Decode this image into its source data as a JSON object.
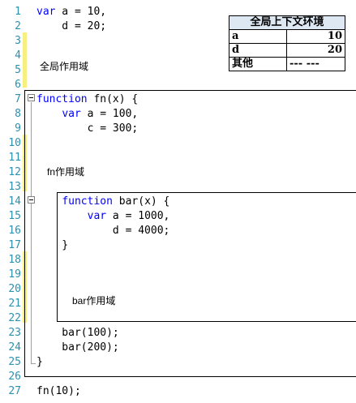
{
  "code": {
    "lines": [
      {
        "num": "1",
        "parts": [
          {
            "t": "var",
            "kw": true
          },
          {
            "t": " a = 10,"
          }
        ]
      },
      {
        "num": "2",
        "parts": [
          {
            "t": "    d = 20;"
          }
        ]
      },
      {
        "num": "3",
        "parts": []
      },
      {
        "num": "4",
        "parts": []
      },
      {
        "num": "5",
        "parts": []
      },
      {
        "num": "6",
        "parts": []
      },
      {
        "num": "7",
        "parts": [
          {
            "t": "function",
            "kw": true
          },
          {
            "t": " fn(x) {"
          }
        ]
      },
      {
        "num": "8",
        "parts": [
          {
            "t": "    "
          },
          {
            "t": "var",
            "kw": true
          },
          {
            "t": " a = 100,"
          }
        ]
      },
      {
        "num": "9",
        "parts": [
          {
            "t": "        c = 300;"
          }
        ]
      },
      {
        "num": "10",
        "parts": []
      },
      {
        "num": "11",
        "parts": []
      },
      {
        "num": "12",
        "parts": []
      },
      {
        "num": "13",
        "parts": []
      },
      {
        "num": "14",
        "parts": [
          {
            "t": "    "
          },
          {
            "t": "function",
            "kw": true
          },
          {
            "t": " bar(x) {"
          }
        ]
      },
      {
        "num": "15",
        "parts": [
          {
            "t": "        "
          },
          {
            "t": "var",
            "kw": true
          },
          {
            "t": " a = 1000,"
          }
        ]
      },
      {
        "num": "16",
        "parts": [
          {
            "t": "            d = 4000;"
          }
        ]
      },
      {
        "num": "17",
        "parts": [
          {
            "t": "    }"
          }
        ]
      },
      {
        "num": "18",
        "parts": []
      },
      {
        "num": "19",
        "parts": []
      },
      {
        "num": "20",
        "parts": []
      },
      {
        "num": "21",
        "parts": []
      },
      {
        "num": "22",
        "parts": []
      },
      {
        "num": "23",
        "parts": [
          {
            "t": "    bar(100);"
          }
        ]
      },
      {
        "num": "24",
        "parts": [
          {
            "t": "    bar(200);"
          }
        ]
      },
      {
        "num": "25",
        "parts": [
          {
            "t": "}"
          }
        ]
      },
      {
        "num": "26",
        "parts": []
      },
      {
        "num": "27",
        "parts": [
          {
            "t": "fn(10);"
          }
        ]
      }
    ]
  },
  "scopes": {
    "global_label": "全局作用域",
    "fn_label": "fn作用域",
    "bar_label": "bar作用域"
  },
  "env_table": {
    "title": "全局上下文环境",
    "rows": [
      {
        "key": "a",
        "value": "10"
      },
      {
        "key": "d",
        "value": "20"
      },
      {
        "key": "其他",
        "value": "--- ---"
      }
    ]
  },
  "colors": {
    "keyword": "#0000ff",
    "line_number": "#2b91af",
    "change_bar": "#f7ef80",
    "table_header": "#dde8f3"
  }
}
